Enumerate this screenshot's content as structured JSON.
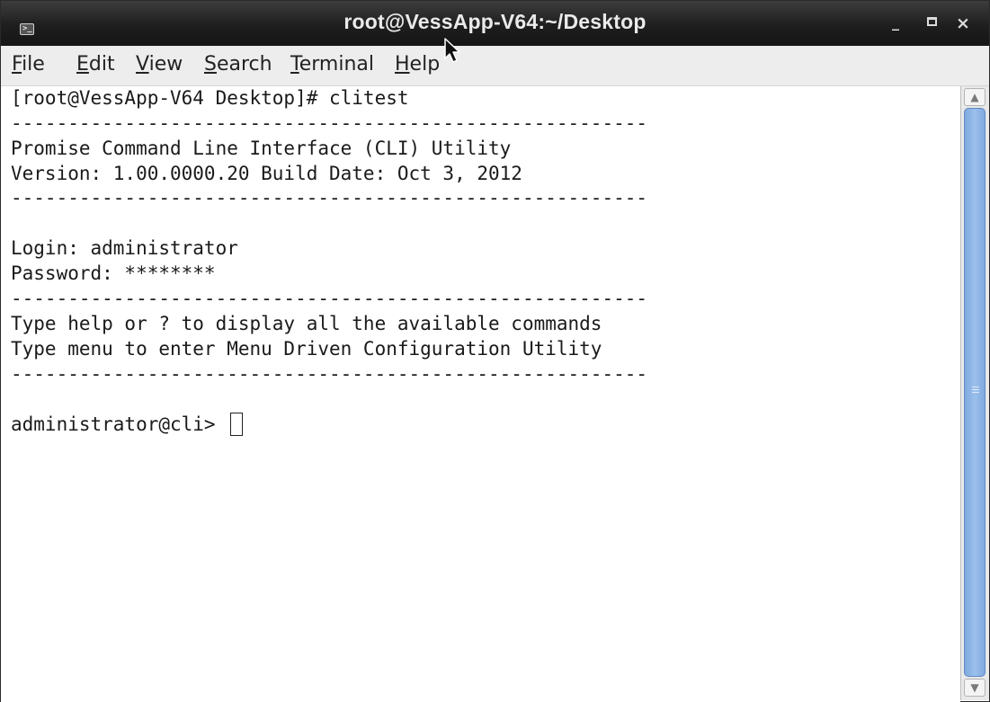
{
  "window": {
    "title": "root@VessApp-V64:~/Desktop",
    "icon": "terminal-icon",
    "controls": {
      "minimize": "_",
      "maximize": "maximize-icon",
      "close": "×"
    }
  },
  "menubar": {
    "items": [
      {
        "first": "F",
        "rest": "ile"
      },
      {
        "first": "E",
        "rest": "dit"
      },
      {
        "first": "V",
        "rest": "iew"
      },
      {
        "first": "S",
        "rest": "earch"
      },
      {
        "first": "T",
        "rest": "erminal"
      },
      {
        "first": "H",
        "rest": "elp"
      }
    ]
  },
  "terminal": {
    "lines": [
      "[root@VessApp-V64 Desktop]# clitest",
      "--------------------------------------------------------",
      "Promise Command Line Interface (CLI) Utility",
      "Version: 1.00.0000.20 Build Date: Oct 3, 2012",
      "--------------------------------------------------------",
      "",
      "Login: administrator",
      "Password: ********",
      "--------------------------------------------------------",
      "Type help or ? to display all the available commands",
      "Type menu to enter Menu Driven Configuration Utility",
      "--------------------------------------------------------",
      "",
      "administrator@cli> "
    ]
  },
  "colors": {
    "titlebar": "#1e1e1e",
    "menubar": "#ededed",
    "scrollbar_thumb": "#8fb5e6",
    "terminal_bg": "#ffffff",
    "terminal_fg": "#1a1a1a"
  }
}
